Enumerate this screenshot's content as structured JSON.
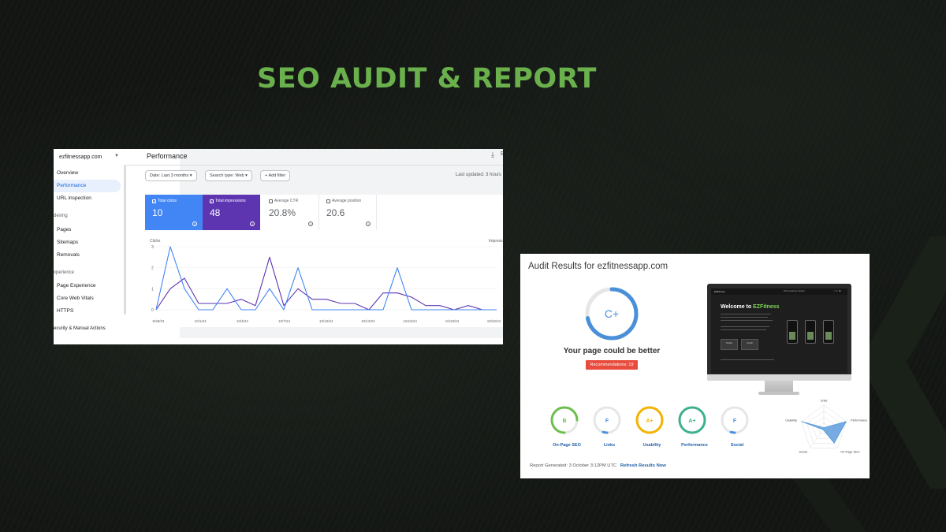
{
  "title": "SEO AUDIT & REPORT",
  "colors": {
    "title_green": "#6ab04c",
    "clicks_blue": "#4285f4",
    "impressions_purple": "#5e35b1",
    "badge_red": "#e74c3c",
    "link_blue": "#1f5fa8"
  },
  "gsc": {
    "property": "ezfitnessapp.com",
    "nav": {
      "overview": "Overview",
      "performance": "Performance",
      "url_inspection": "URL inspection",
      "section_indexing": "dexing",
      "pages": "Pages",
      "sitemaps": "Sitemaps",
      "removals": "Removals",
      "section_experience": "xperience",
      "page_experience": "Page Experience",
      "core_web_vitals": "Core Web Vitals",
      "https": "HTTPS",
      "section_security": "ecurity & Manual Actions"
    },
    "page_title": "Performance",
    "download_icon": "download-icon",
    "export_label": "E",
    "filters": {
      "date": "Date: Last 3 months",
      "search_type": "Search type: Web",
      "add_filter": "Add filter"
    },
    "last_updated": "Last updated: 3 hours",
    "metrics": {
      "clicks_label": "Total clicks",
      "clicks_value": "10",
      "impressions_label": "Total impressions",
      "impressions_value": "48",
      "ctr_label": "Average CTR",
      "ctr_value": "20.8%",
      "position_label": "Average position",
      "position_value": "20.6"
    }
  },
  "chart_data": {
    "type": "line",
    "ylabel": "Clicks",
    "y2label": "Impress",
    "ylim": [
      0,
      3
    ],
    "y_ticks": [
      "3",
      "2",
      "1",
      "0"
    ],
    "x_ticks": [
      "9/28/24",
      "10/1/24",
      "10/4/24",
      "10/7/24",
      "10/10/24",
      "10/13/24",
      "10/16/24",
      "10/19/24",
      "10/22/24"
    ],
    "series": [
      {
        "name": "Total clicks",
        "color": "#4285f4",
        "values": [
          0,
          3,
          1,
          0,
          0,
          1,
          0,
          0,
          1,
          0,
          2,
          0,
          0,
          0,
          0,
          0,
          0,
          2,
          0,
          0,
          0,
          0,
          0,
          0,
          0
        ]
      },
      {
        "name": "Total impressions",
        "color": "#5e35b1",
        "values": [
          0,
          1,
          1.5,
          0.3,
          0.3,
          0.3,
          0.5,
          0.2,
          2.5,
          0.2,
          1,
          0.5,
          0.5,
          0.3,
          0.3,
          0,
          0.8,
          0.8,
          0.6,
          0.2,
          0.2,
          0,
          0.2,
          0,
          0
        ]
      }
    ]
  },
  "audit": {
    "title": "Audit Results for ezfitnessapp.com",
    "grade": "C+",
    "grade_fraction": 0.72,
    "message": "Your page could be better",
    "recommendations": "Recommendations: 19",
    "preview": {
      "logo": "EZFitness",
      "nav": "Home   Features   Contact",
      "welcome_prefix": "Welcome to ",
      "welcome_brand": "EZFitness",
      "btn1": "Healthy",
      "btn2": "Growth"
    },
    "scores": [
      {
        "grade": "B",
        "label": "On-Page SEO",
        "color": "#6cc04a",
        "fraction": 0.75
      },
      {
        "grade": "F",
        "label": "Links",
        "color": "#4a90d9",
        "fraction": 0.05
      },
      {
        "grade": "A+",
        "label": "Usability",
        "color": "#f5b301",
        "fraction": 1.0
      },
      {
        "grade": "A+",
        "label": "Performance",
        "color": "#3fb08f",
        "fraction": 1.0
      },
      {
        "grade": "F",
        "label": "Social",
        "color": "#4a90d9",
        "fraction": 0.05
      }
    ],
    "radar": {
      "axes": [
        "Links",
        "Performance",
        "On-Page SEO",
        "Social",
        "Usability"
      ],
      "values": [
        0.05,
        1.0,
        0.75,
        0.05,
        1.0
      ]
    },
    "footer": "Report Generated: 3 October 3:12PM UTC",
    "refresh": "Refresh Results Now"
  }
}
